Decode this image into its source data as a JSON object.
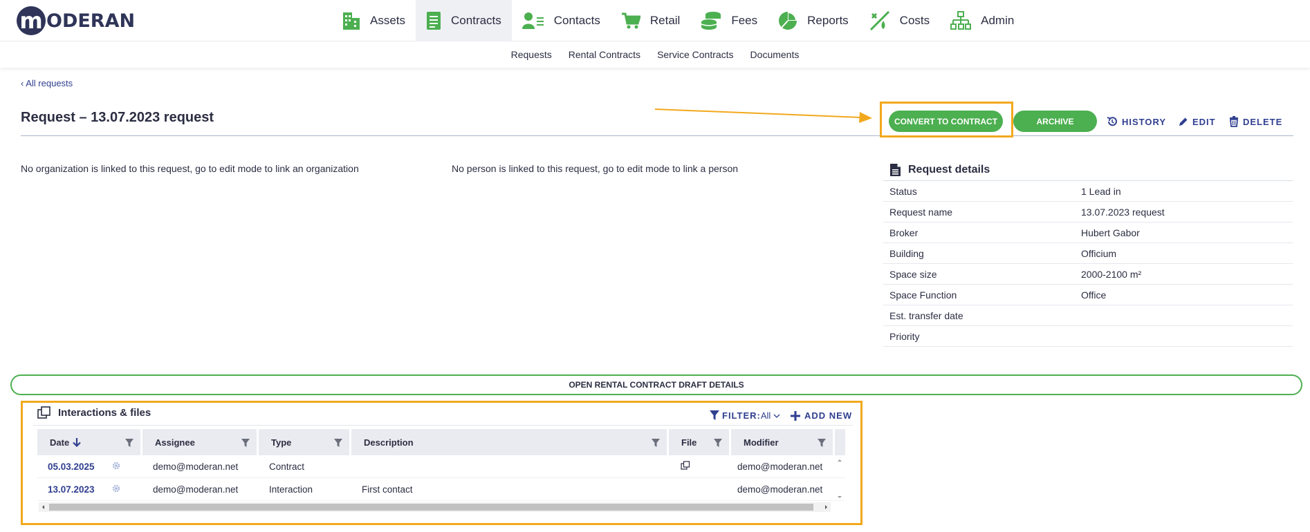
{
  "brand": {
    "logo_letter": "m",
    "logo_text": "ODERAN"
  },
  "colors": {
    "accent_green": "#4caf50",
    "link_blue": "#2f3e8f",
    "highlight_orange": "#f2a81d",
    "navy": "#2f3458"
  },
  "main_nav": [
    {
      "label": "Assets",
      "icon": "buildings-icon"
    },
    {
      "label": "Contracts",
      "icon": "contract-document-icon",
      "active": true
    },
    {
      "label": "Contacts",
      "icon": "contacts-icon"
    },
    {
      "label": "Retail",
      "icon": "shopping-cart-icon"
    },
    {
      "label": "Fees",
      "icon": "coins-icon"
    },
    {
      "label": "Reports",
      "icon": "pie-chart-icon"
    },
    {
      "label": "Costs",
      "icon": "costs-icon"
    },
    {
      "label": "Admin",
      "icon": "org-chart-icon"
    }
  ],
  "sub_nav": [
    "Requests",
    "Rental Contracts",
    "Service Contracts",
    "Documents"
  ],
  "breadcrumb": {
    "chevron": "‹",
    "label": "All requests"
  },
  "page": {
    "title": "Request – 13.07.2023 request"
  },
  "actions": {
    "convert": "CONVERT TO CONTRACT",
    "archive": "ARCHIVE",
    "history": "HISTORY",
    "edit": "EDIT",
    "delete": "DELETE"
  },
  "messages": {
    "no_org": "No organization is linked to this request, go to edit mode to link an organization",
    "no_person": "No person is linked to this request, go to edit mode to link a person"
  },
  "details": {
    "title": "Request details",
    "rows": [
      {
        "label": "Status",
        "value": "1 Lead in"
      },
      {
        "label": "Request name",
        "value": "13.07.2023 request"
      },
      {
        "label": "Broker",
        "value": "Hubert Gabor"
      },
      {
        "label": "Building",
        "value": "Officium"
      },
      {
        "label": "Space size",
        "value": "2000-2100 m²"
      },
      {
        "label": "Space Function",
        "value": "Office"
      },
      {
        "label": "Est. transfer date",
        "value": ""
      },
      {
        "label": "Priority",
        "value": ""
      }
    ]
  },
  "open_draft_label": "OPEN RENTAL CONTRACT DRAFT DETAILS",
  "interactions": {
    "title": "Interactions & files",
    "filter_label": "FILTER:",
    "filter_value": "All",
    "add_new": "ADD NEW",
    "columns": [
      "Date",
      "Assignee",
      "Type",
      "Description",
      "File",
      "Modifier"
    ],
    "rows": [
      {
        "date": "05.03.2025",
        "assignee": "demo@moderan.net",
        "type": "Contract",
        "description": "",
        "has_file": true,
        "modifier": "demo@moderan.net"
      },
      {
        "date": "13.07.2023",
        "assignee": "demo@moderan.net",
        "type": "Interaction",
        "description": "First contact",
        "has_file": false,
        "modifier": "demo@moderan.net"
      }
    ]
  }
}
